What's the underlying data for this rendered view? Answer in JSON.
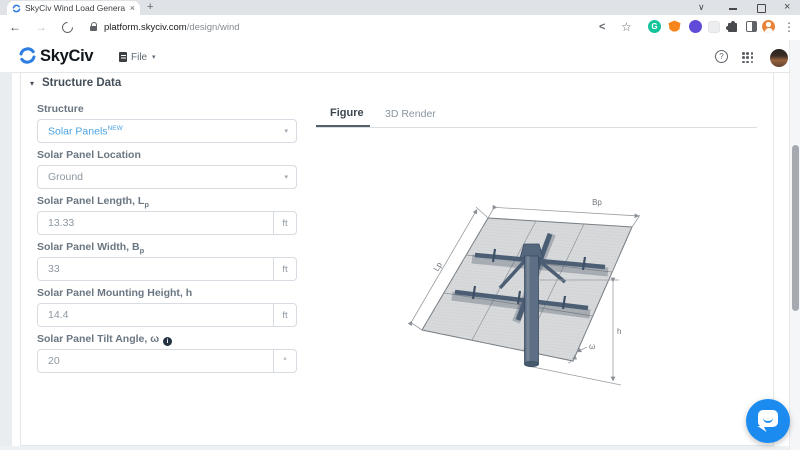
{
  "browser": {
    "tab_title": "SkyCiv Wind Load Genera",
    "icons": {
      "tab_close": "×",
      "new_tab": "+",
      "window_menu": "∨",
      "window_close": "×",
      "back": "←",
      "forward": "→",
      "share": "<",
      "bookmark_star": "☆",
      "grammarly_letter": "G",
      "overflow_menu": "⋮"
    },
    "url": {
      "host": "platform.skyciv.com",
      "path": "/design/wind"
    }
  },
  "header": {
    "logo_text": "SkyCiv",
    "file_label": "File",
    "file_caret": "▾",
    "help_glyph": "?"
  },
  "form": {
    "section": {
      "caret": "▾",
      "title": "Structure Data"
    },
    "dropdown_caret": "▾",
    "fields": [
      {
        "label": "Structure",
        "value": "Solar Panels",
        "badge": "NEW"
      },
      {
        "label": "Solar Panel Location",
        "value": "Ground"
      },
      {
        "label": "Solar Panel Length, L",
        "sub": "p",
        "value": "13.33",
        "unit": "ft"
      },
      {
        "label": "Solar Panel Width, B",
        "sub": "p",
        "value": "33",
        "unit": "ft"
      },
      {
        "label": "Solar Panel Mounting Height, h",
        "value": "14.4",
        "unit": "ft"
      },
      {
        "label": "Solar Panel Tilt Angle, ω",
        "info": "i",
        "value": "20",
        "unit": "°"
      }
    ]
  },
  "tabs": {
    "figure": "Figure",
    "render3d": "3D Render"
  },
  "figure": {
    "dim_bp": "Bp",
    "dim_lp": "Lp",
    "dim_h": "h",
    "dim_omega": "ω"
  },
  "colors": {
    "accent_blue": "#4ba3e2",
    "intercom_blue": "#1c8bf0",
    "panel_gray": "#d8dadc",
    "beam_steel": "#4c5e74",
    "logo_blue": "#2e7de0"
  }
}
